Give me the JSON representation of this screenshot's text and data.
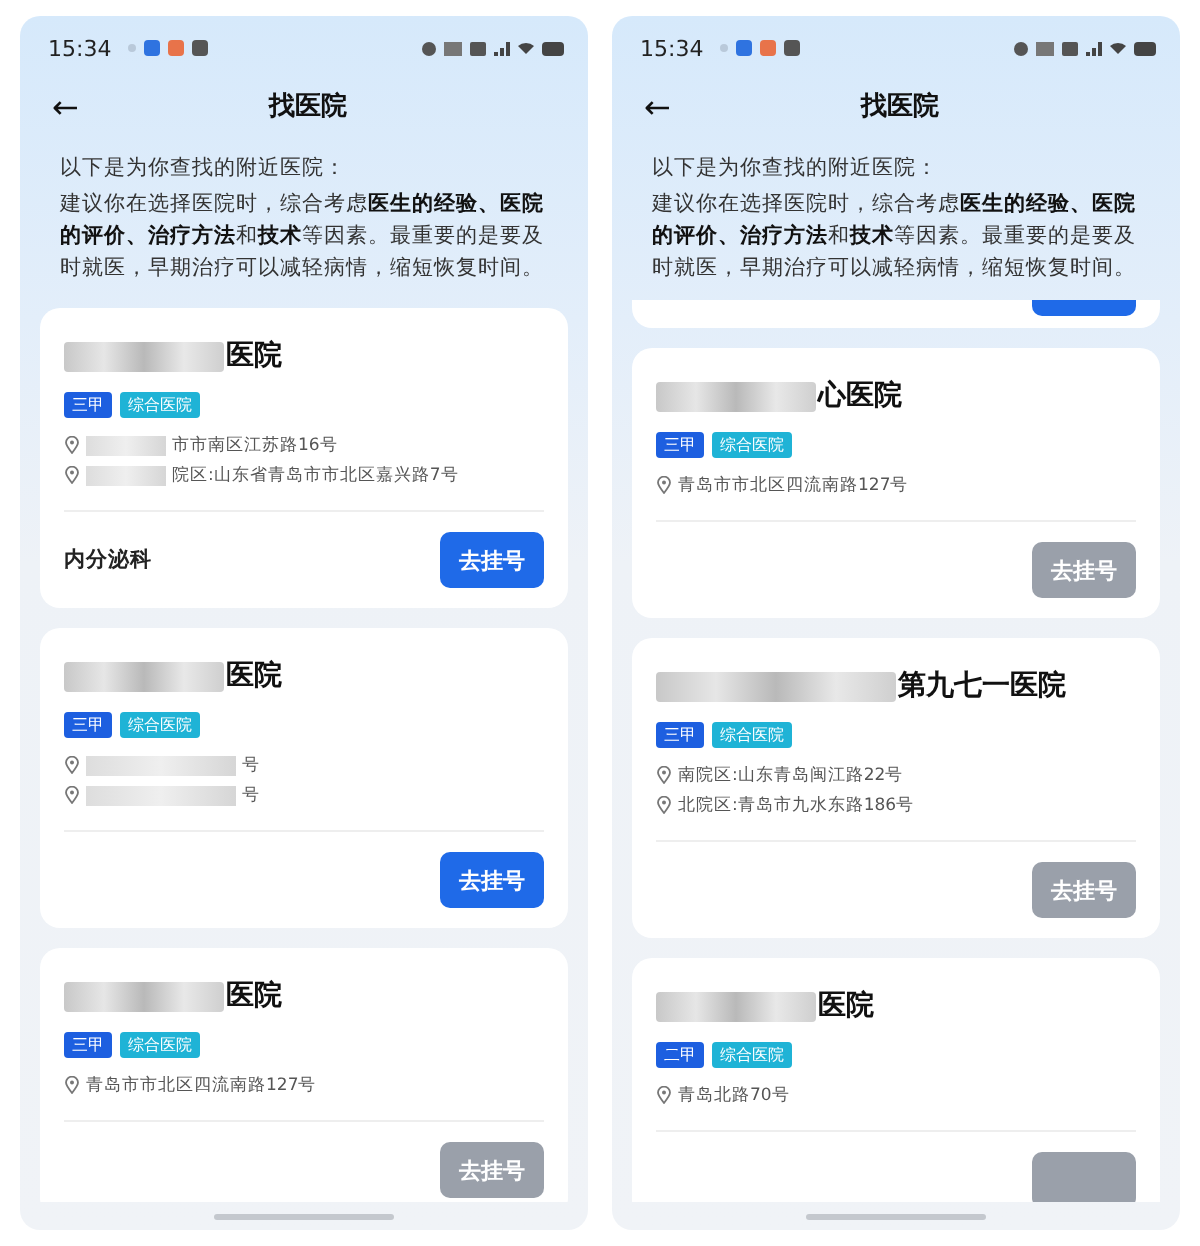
{
  "screens": [
    {
      "status_bar": {
        "time": "15:34"
      },
      "header": {
        "back": "←",
        "title": "找医院"
      },
      "intro": {
        "lead": "以下是为你查找的附近医院：",
        "advice": "建议你在选择医院时，综合考虑**医生的经验、医院的评价、治疗方法**和**技术**等因素。最重要的是要及时就医，早期治疗可以减轻病情，缩短恢复时间。"
      },
      "hospitals": [
        {
          "kind": "full",
          "name": "医院",
          "redacted": true,
          "tags": [
            {
              "kind": "grade",
              "label": "三甲"
            },
            {
              "kind": "type",
              "label": "综合医院"
            }
          ],
          "addresses": [
            {
              "text": "市市南区江苏路16号",
              "redacted": true
            },
            {
              "text": "院区:山东省青岛市市北区嘉兴路7号",
              "redacted": true
            }
          ],
          "department": "内分泌科",
          "button": {
            "label": "去挂号",
            "disabled": false
          }
        },
        {
          "kind": "full",
          "name": "医院",
          "redacted": true,
          "tags": [
            {
              "kind": "grade",
              "label": "三甲"
            },
            {
              "kind": "type",
              "label": "综合医院"
            }
          ],
          "addresses": [
            {
              "text": "号",
              "redacted": true
            },
            {
              "text": "号",
              "redacted": true
            }
          ],
          "button": {
            "label": "去挂号",
            "disabled": false
          }
        },
        {
          "kind": "full",
          "name": "医院",
          "redacted": true,
          "tags": [
            {
              "kind": "grade",
              "label": "三甲"
            },
            {
              "kind": "type",
              "label": "综合医院"
            }
          ],
          "addresses": [
            {
              "text": "青岛市市北区四流南路127号",
              "redacted": false
            }
          ],
          "button": {
            "label": "去挂号",
            "disabled": true
          }
        }
      ]
    },
    {
      "status_bar": {
        "time": "15:34"
      },
      "header": {
        "back": "←",
        "title": "找医院"
      },
      "intro": {
        "lead": "以下是为你查找的附近医院：",
        "advice": "建议你在选择医院时，综合考虑**医生的经验、医院的评价、治疗方法**和**技术**等因素。最重要的是要及时就医，早期治疗可以减轻病情，缩短恢复时间。"
      },
      "hospitals": [
        {
          "kind": "cut",
          "button": {
            "disabled": false
          }
        },
        {
          "kind": "full",
          "name": "心医院",
          "redacted": true,
          "tags": [
            {
              "kind": "grade",
              "label": "三甲"
            },
            {
              "kind": "type",
              "label": "综合医院"
            }
          ],
          "addresses": [
            {
              "text": "青岛市市北区四流南路127号",
              "redacted": false
            }
          ],
          "button": {
            "label": "去挂号",
            "disabled": true
          }
        },
        {
          "kind": "full",
          "name": "第九七一医院",
          "redacted": true,
          "tags": [
            {
              "kind": "grade",
              "label": "三甲"
            },
            {
              "kind": "type",
              "label": "综合医院"
            }
          ],
          "addresses": [
            {
              "text": "南院区:山东青岛闽江路22号",
              "redacted": false
            },
            {
              "text": "北院区:青岛市九水东路186号",
              "redacted": false
            }
          ],
          "button": {
            "label": "去挂号",
            "disabled": true
          }
        },
        {
          "kind": "full",
          "name": "医院",
          "redacted": true,
          "tags": [
            {
              "kind": "grade",
              "label": "二甲"
            },
            {
              "kind": "type",
              "label": "综合医院"
            }
          ],
          "addresses": [
            {
              "text": "青岛北路70号",
              "redacted": false
            }
          ],
          "button": {
            "disabled": true
          }
        }
      ]
    }
  ]
}
